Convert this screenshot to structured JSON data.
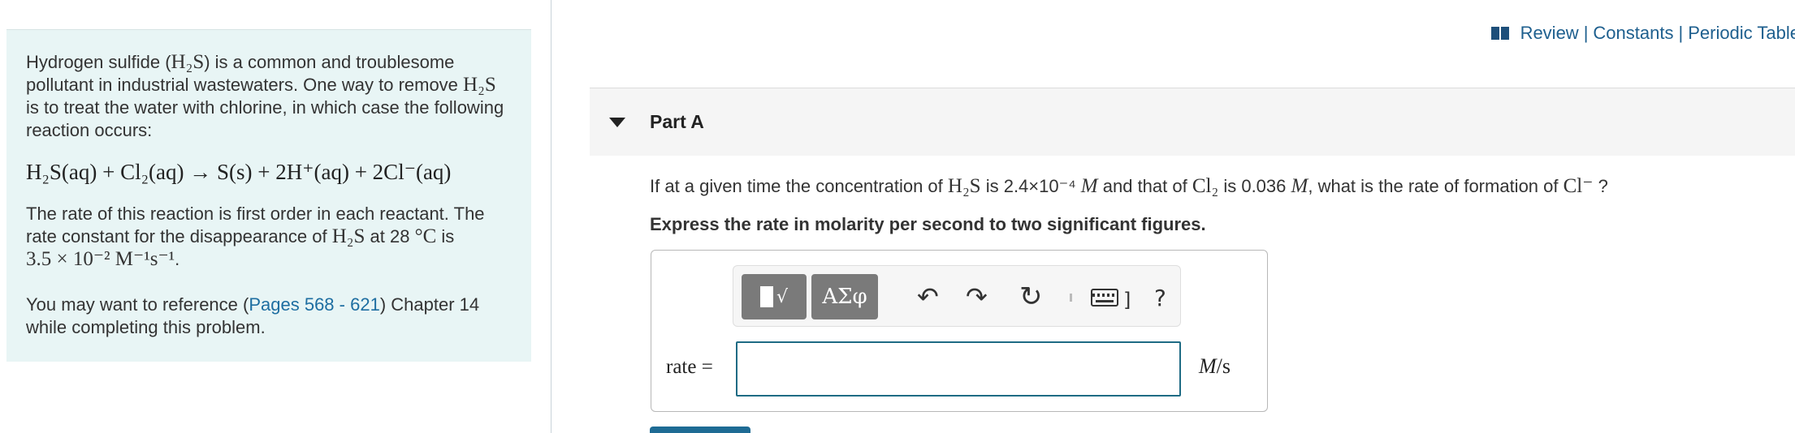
{
  "intro": {
    "p1_a": "Hydrogen sulfide (",
    "p1_formula": "H₂S",
    "p1_b": ") is a common and troublesome pollutant in industrial wastewaters. One way to remove",
    "p1_c": "is to treat the water with chlorine, in which case the following reaction occurs:",
    "equation": "H₂S(aq) + Cl₂(aq) → S(s) + 2H⁺(aq) + 2Cl⁻(aq)",
    "p2_a": "The rate of this reaction is first order in each reactant. The rate constant for the disappearance of",
    "p2_formula": "H₂S",
    "p2_b": "at 28",
    "p2_temp": "°C",
    "p2_c": "is",
    "p2_k": "3.5 × 10⁻² M⁻¹s⁻¹",
    "p3_a": "You may want to reference (",
    "p3_link": "Pages 568 - 621",
    "p3_b": ") Chapter 14 while completing this problem."
  },
  "top_links": {
    "review": "Review",
    "constants": "Constants",
    "periodic": "Periodic Table",
    "separator": "|"
  },
  "part": {
    "title": "Part A",
    "question_a": "If at a given time the concentration of",
    "h2s": "H₂S",
    "question_b": "is 2.4×10⁻⁴",
    "M1": "M",
    "question_c": "and that of",
    "cl2": "Cl₂",
    "question_d": "is 0.036",
    "M2": "M",
    "question_e": ", what is the rate of formation of",
    "clminus": "Cl⁻",
    "question_f": "?",
    "instruction": "Express the rate in molarity per second to two significant figures."
  },
  "toolbar": {
    "greek": "ΑΣφ",
    "radical": "√",
    "undo": "↶",
    "redo": "↷",
    "reset": "↻",
    "bracket": "]",
    "help": "?"
  },
  "answer": {
    "label": "rate =",
    "value": "",
    "units_a": "M",
    "units_b": "/s"
  },
  "icons": {
    "book": "book-icon",
    "collapse": "triangle-down-icon",
    "templates": "templates-icon",
    "undo": "undo-icon",
    "redo": "redo-icon",
    "reset": "reset-icon",
    "keyboard": "keyboard-icon",
    "help": "help-icon"
  },
  "colors": {
    "panel_bg": "#e8f5f5",
    "link": "#1e6ea1",
    "input_border": "#1e6b84"
  }
}
